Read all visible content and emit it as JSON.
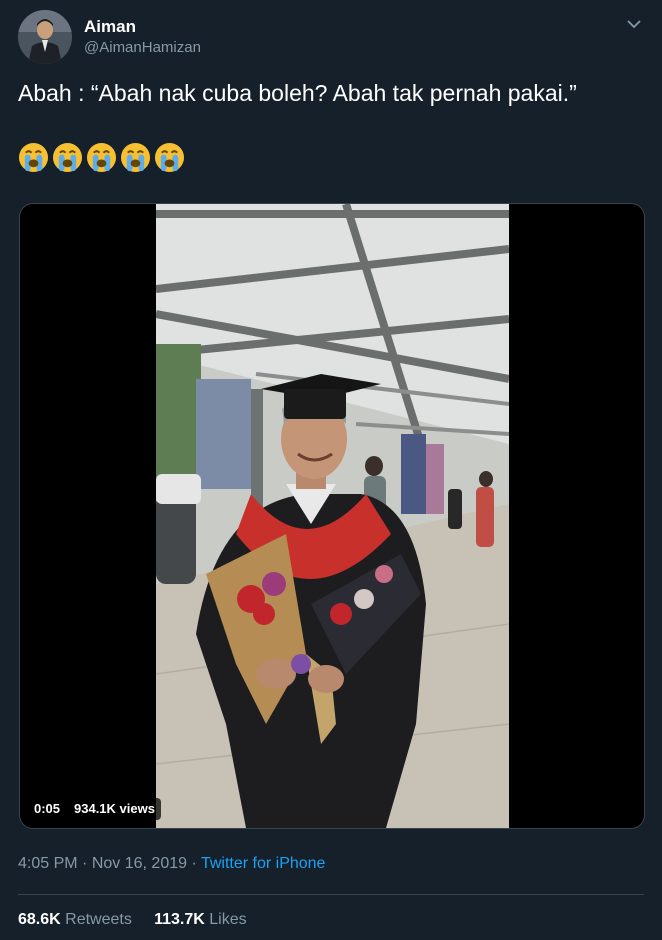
{
  "author": {
    "name": "Aiman",
    "handle": "@AimanHamizan",
    "avatar_icon": "profile-photo"
  },
  "tweet": {
    "text": "Abah : “Abah nak cuba boleh? Abah tak pernah pakai.”",
    "emoji_count": 5,
    "emoji_icon": "loudly-crying-face-icon"
  },
  "video": {
    "elapsed": "0:05",
    "views": "934.1K views"
  },
  "meta": {
    "time": "4:05 PM",
    "separator": "·",
    "date": "Nov 16, 2019",
    "client": "Twitter for iPhone"
  },
  "stats": {
    "retweets_count": "68.6K",
    "retweets_label": "Retweets",
    "likes_count": "113.7K",
    "likes_label": "Likes"
  },
  "colors": {
    "background": "#15202b",
    "secondary_text": "#8899a6",
    "link": "#1da1f2",
    "divider": "#38444d"
  }
}
